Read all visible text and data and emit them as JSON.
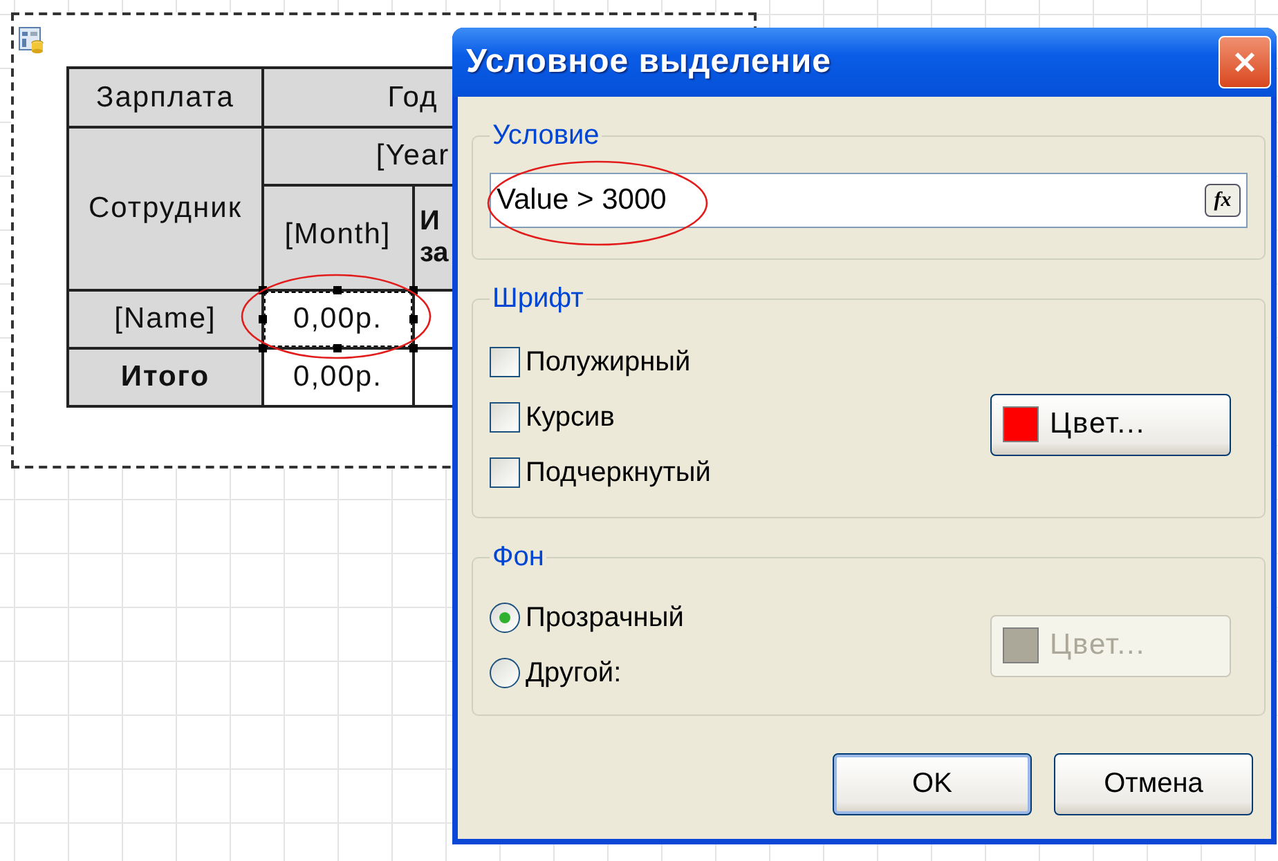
{
  "report": {
    "table": {
      "rows": [
        [
          {
            "kind": "header",
            "text": "Зарплата",
            "bold": false
          },
          {
            "kind": "header",
            "text": "Год",
            "bold": false,
            "colspan": 2
          }
        ],
        [
          {
            "kind": "header",
            "text": "Сотрудник",
            "bold": false,
            "rowspan": 2
          },
          {
            "kind": "header",
            "text": "[Year",
            "bold": false,
            "colspan": 2
          }
        ],
        [
          {
            "kind": "header",
            "text": "[Month]",
            "bold": false
          },
          {
            "kind": "header",
            "lines": [
              "И",
              "за"
            ],
            "bold": true
          }
        ],
        [
          {
            "kind": "header",
            "text": "[Name]",
            "bold": false
          },
          {
            "kind": "data",
            "text": "0,00р.",
            "selected": true
          },
          {
            "kind": "data",
            "selected": false
          }
        ],
        [
          {
            "kind": "header",
            "text": "Итого",
            "bold": true
          },
          {
            "kind": "data",
            "text": "0,00р.",
            "selected": false
          },
          {
            "kind": "data",
            "selected": false
          }
        ]
      ]
    }
  },
  "dialog": {
    "title": "Условное выделение",
    "condition": {
      "legend": "Условие",
      "value": "Value > 3000",
      "button": "fx"
    },
    "font": {
      "legend": "Шрифт",
      "checkboxes": [
        {
          "label": "Полужирный",
          "checked": false
        },
        {
          "label": "Курсив",
          "checked": false
        },
        {
          "label": "Подчеркнутый",
          "checked": false
        }
      ],
      "color_button": {
        "label": "Цвет...",
        "color": "#ff0000",
        "disabled": false
      }
    },
    "background": {
      "legend": "Фон",
      "options": [
        {
          "label": "Прозрачный",
          "selected": true
        },
        {
          "label": "Другой:",
          "selected": false
        }
      ],
      "color_button": {
        "label": "Цвет...",
        "color": "#aca899",
        "disabled": true
      }
    },
    "buttons": [
      {
        "label": "OK",
        "default": true
      },
      {
        "label": "Отмена",
        "default": false
      }
    ]
  }
}
